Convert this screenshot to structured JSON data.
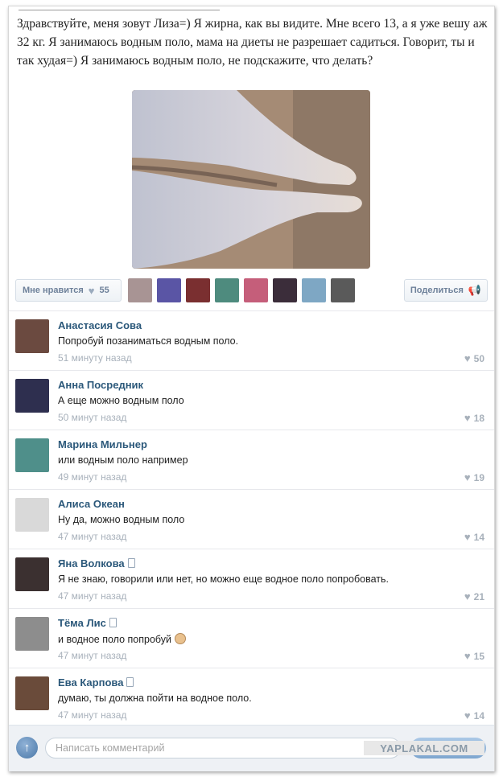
{
  "post": {
    "text": "Здравствуйте, меня зовут Лиза=) Я жирна, как вы видите. Мне всего 13, а я уже вешу аж 32 кг. Я занимаюсь водным поло, мама на диеты не разрешает садиться. Говорит, ты и так худая=) Я занимаюсь водным поло, не подскажите, что делать?"
  },
  "like_bar": {
    "like_label": "Мне нравится",
    "like_count": "55",
    "share_label": "Поделиться",
    "liker_colors": [
      "#a89494",
      "#5a55a5",
      "#7a2f30",
      "#4e8b7e",
      "#c55e7a",
      "#3b2d3a",
      "#7ea7c4",
      "#5a5a5a"
    ]
  },
  "comments": [
    {
      "author": "Анастасия Сова",
      "mobile": false,
      "text": "Попробуй позаниматься водным поло.",
      "time": "51 минуту назад",
      "likes": "50",
      "avatar_color": "#6b4a40"
    },
    {
      "author": "Анна Посредник",
      "mobile": false,
      "text": "А еще можно водным поло",
      "time": "50 минут назад",
      "likes": "18",
      "avatar_color": "#2e2f4f"
    },
    {
      "author": "Марина Мильнер",
      "mobile": false,
      "text": "или водным поло например",
      "time": "49 минут назад",
      "likes": "19",
      "avatar_color": "#4f8f8a"
    },
    {
      "author": "Алиса Океан",
      "mobile": false,
      "text": "Ну да, можно водным поло",
      "time": "47 минут назад",
      "likes": "14",
      "avatar_color": "#d9d9d9"
    },
    {
      "author": "Яна Волкова",
      "mobile": true,
      "text": "Я не знаю,  говорили или нет,  но можно еще водное поло попробовать.",
      "time": "47 минут назад",
      "likes": "21",
      "avatar_color": "#3b3030"
    },
    {
      "author": "Тёма Лис",
      "mobile": true,
      "text": "и водное поло попробуй",
      "time": "47 минут назад",
      "likes": "15",
      "avatar_color": "#8d8d8d"
    },
    {
      "author": "Ева Карпова",
      "mobile": true,
      "text": "думаю, ты должна пойти на водное поло.",
      "time": "47 минут назад",
      "likes": "14",
      "avatar_color": "#6a4b3a"
    }
  ],
  "composer": {
    "placeholder": "Написать комментарий"
  },
  "watermark": "YAPLAKAL.COM"
}
